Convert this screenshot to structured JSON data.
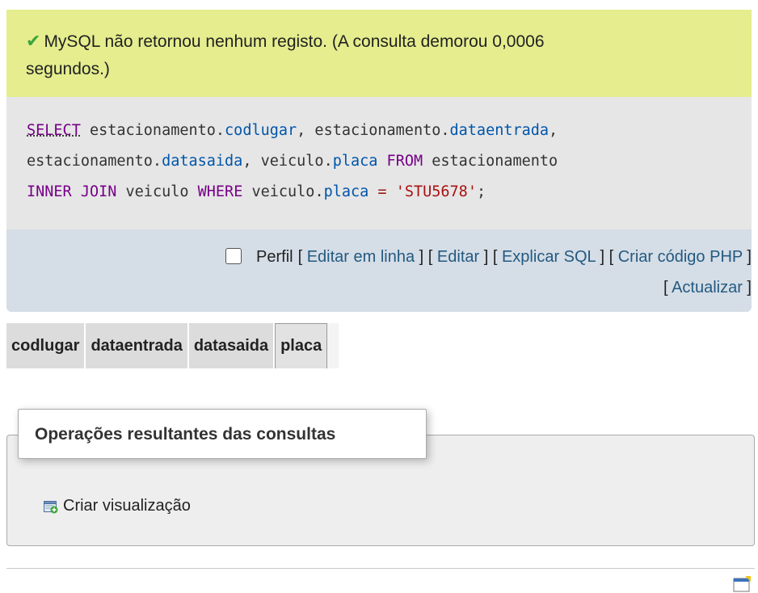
{
  "success": {
    "icon": "check-icon",
    "line1": "MySQL não retornou nenhum registo. (A consulta demorou 0,0006",
    "line2": "segundos.)"
  },
  "sql": {
    "select": "SELECT",
    "l1_a": " estacionamento.",
    "l1_f1": "codlugar",
    "l1_b": ", estacionamento.",
    "l1_f2": "dataentrada",
    "l1_c": ",",
    "l2_a": "estacionamento.",
    "l2_f1": "datasaida",
    "l2_b": ", veiculo.",
    "l2_f2": "placa",
    "l2_kw": " FROM",
    "l2_c": " estacionamento",
    "l3_kw1": "INNER JOIN",
    "l3_a": " veiculo ",
    "l3_kw2": "WHERE",
    "l3_b": " veiculo.",
    "l3_f": "placa",
    "l3_op": " = ",
    "l3_str": "'STU5678'",
    "l3_end": ";"
  },
  "actions": {
    "perfil_label": "Perfil",
    "editar_em_linha": "Editar em linha",
    "editar": "Editar",
    "explicar_sql": "Explicar SQL",
    "criar_codigo_php": "Criar código PHP",
    "actualizar": "Actualizar"
  },
  "results": {
    "columns": [
      "codlugar",
      "dataentrada",
      "datasaida",
      "placa"
    ]
  },
  "operations": {
    "legend": "Operações resultantes das consultas",
    "criar_visualizacao": "Criar visualização"
  }
}
